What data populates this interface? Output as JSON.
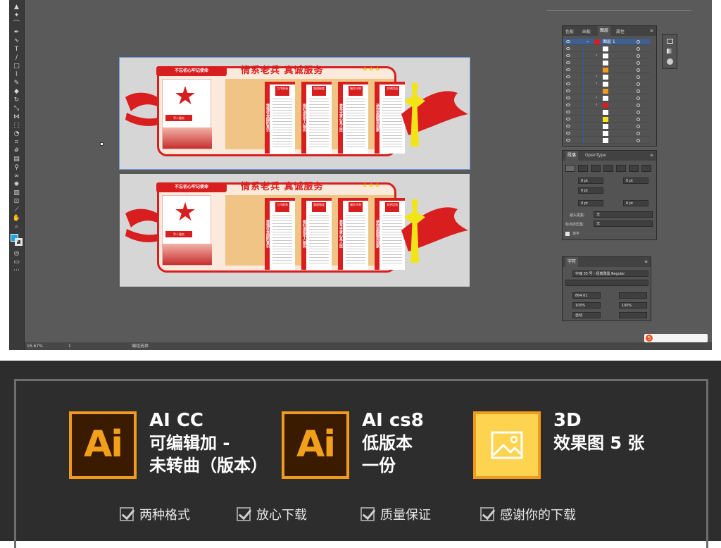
{
  "layers_panel": {
    "tabs": [
      "色板",
      "画板",
      "图层",
      "属性"
    ],
    "active_tab": "图层",
    "layer_name": "图层 1"
  },
  "paragraph_panel": {
    "tabs": [
      "段落",
      "OpenType"
    ],
    "indent_left": "0 pt",
    "indent_right": "0 pt",
    "indent_first": "0 pt",
    "space_before": "0 pt",
    "space_after": "0 pt",
    "kinsoku_label": "避头尾集:",
    "kinsoku_value": "无",
    "mojikumi_label": "标点挤压集:",
    "mojikumi_value": "无",
    "hyphen_label": "连字"
  },
  "character_panel": {
    "title": "字符",
    "font": "字魂 35 号 - 经典雅黑 Regular",
    "size": "864.61",
    "scale_v": "100%",
    "scale_h": "100%",
    "leading": "自动"
  },
  "status_bar": {
    "zoom": "16.67%",
    "page": "1",
    "tool": "编组选择"
  },
  "board": {
    "banner": "不忘初心牢记使命",
    "title": "情系老兵 真诚服务",
    "emblem_label": "军人服务",
    "columns": [
      {
        "head": "工作职责",
        "side": "增强社会国防意识"
      },
      {
        "head": "管理制度",
        "side": "搞好退役军人服务"
      },
      {
        "head": "服务守则",
        "side": "参军守家心系人民"
      },
      {
        "head": "文明用语",
        "side": "送你爱国服务到家"
      }
    ]
  },
  "info": {
    "items": [
      {
        "icon": "Ai",
        "line1": "AI CC",
        "line2": "可编辑加 -",
        "line3": "未转曲（版本）"
      },
      {
        "icon": "Ai",
        "line1": "AI cs8",
        "line2": "低版本",
        "line3": "一份"
      },
      {
        "icon": "image",
        "line1": "3D",
        "line2": "效果图 5 张",
        "line3": ""
      }
    ],
    "features": [
      "两种格式",
      "放心下载",
      "质量保证",
      "感谢你的下载"
    ]
  },
  "colors": {
    "brand_red": "#d81e1e",
    "ai_orange": "#f29a1c",
    "ai_dark": "#3b1b00",
    "image_yellow": "#fdd34f"
  }
}
